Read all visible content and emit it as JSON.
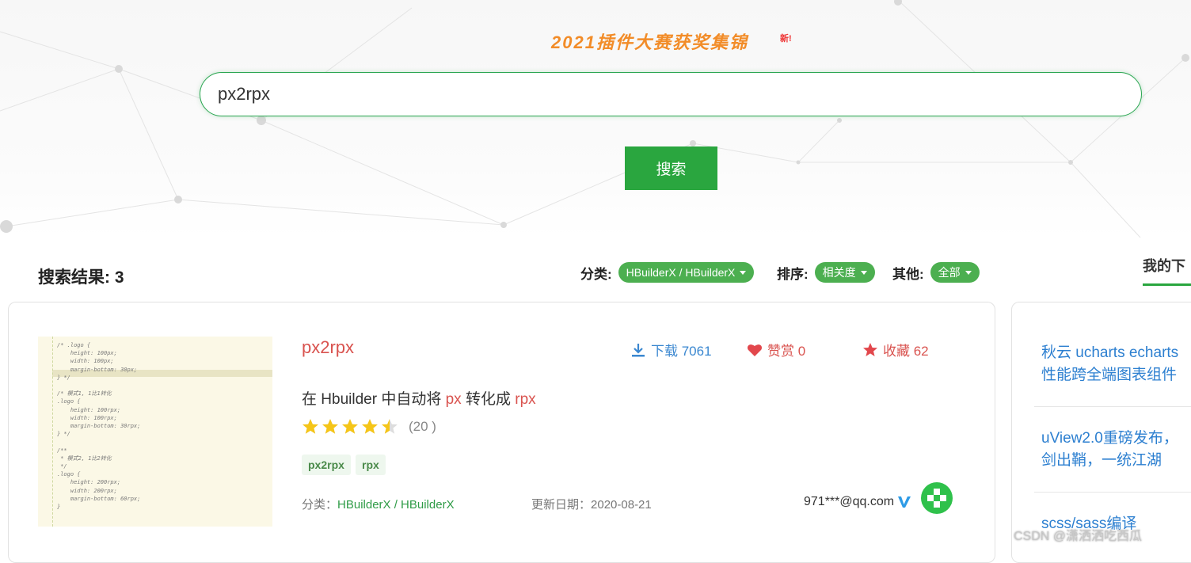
{
  "banner": {
    "text": "2021插件大赛获奖集锦",
    "badge": "新!"
  },
  "search": {
    "value": "px2rpx",
    "button_label": "搜索"
  },
  "results": {
    "label": "搜索结果: 3"
  },
  "filters": {
    "category": {
      "label": "分类:",
      "value": "HBuilderX / HBuilderX"
    },
    "sort": {
      "label": "排序:",
      "value": "相关度"
    },
    "other": {
      "label": "其他:",
      "value": "全部"
    }
  },
  "side_tab": {
    "label": "我的下"
  },
  "plugin": {
    "title": "px2rpx",
    "downloads": "下载 7061",
    "likes": "赞赏 0",
    "favorites": "收藏 62",
    "description": {
      "prefix": "在 Hbuilder 中自动将 ",
      "px": "px",
      "middle": " 转化成 ",
      "rpx": "rpx"
    },
    "rating": 4.5,
    "rating_count": "(20 )",
    "tags": [
      "px2rpx",
      "rpx"
    ],
    "category_label": "分类：",
    "category_value": "HBuilderX / HBuilderX",
    "updated_label": "更新日期：",
    "updated_value": "2020-08-21",
    "author": "971***@qq.com"
  },
  "thumbnail_code": "/* .logo {\n    height: 100px;\n    width: 100px;\n    margin-bottom: 30px;\n} */\n\n/* 模式1, 1比1转化\n.logo {\n    height: 100rpx;\n    width: 100rpx;\n    margin-bottom: 30rpx;\n} */\n\n/**\n * 模式2, 1比2转化\n */\n.logo {\n    height: 200rpx;\n    width: 200rpx;\n    margin-bottom: 60rpx;\n}",
  "sidebar": {
    "items": [
      {
        "line1": "秋云 ucharts echarts",
        "line2": "性能跨全端图表组件"
      },
      {
        "line1": "uView2.0重磅发布，",
        "line2": "剑出鞘，一统江湖"
      },
      {
        "line1": "scss/sass编译",
        "line2": ""
      }
    ]
  },
  "watermark": "CSDN @潇洒洒吃西瓜",
  "colors": {
    "accent": "#2aa63f",
    "title_red": "#d9534f",
    "link_blue": "#2c7fd0",
    "star": "#f5c518"
  }
}
